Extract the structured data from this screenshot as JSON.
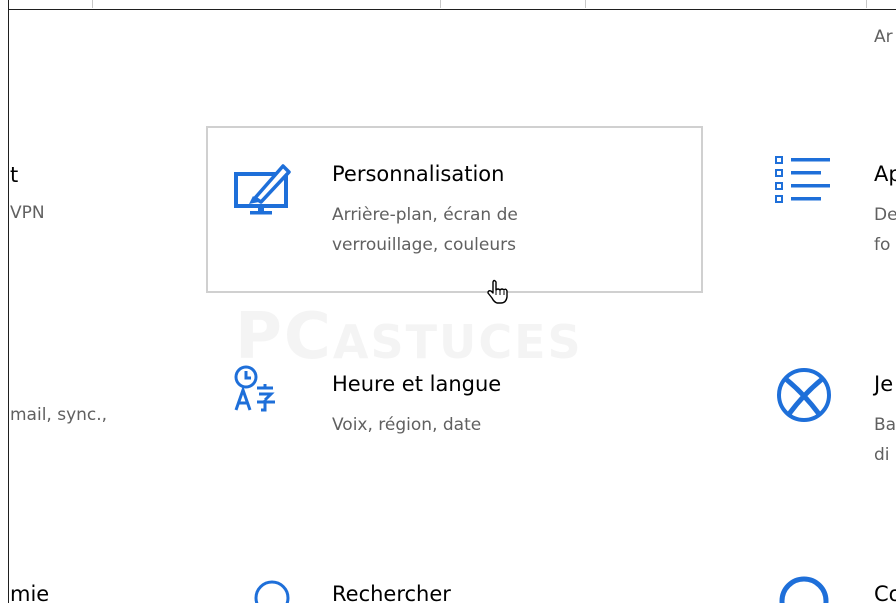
{
  "colors": {
    "accent": "#1e6fd9",
    "title": "#000000",
    "desc": "#606060",
    "hover_border": "#d0d0d0"
  },
  "top_right_partial": "Ar",
  "left_column": {
    "row1_title_fragment": "t",
    "row1_desc_fragment": "VPN",
    "row2_desc_fragment": "mail, sync.,",
    "row3_title_fragment": "mie"
  },
  "tiles": [
    {
      "id": "personnalisation",
      "title": "Personnalisation",
      "desc_line1": "Arrière-plan, écran de",
      "desc_line2": "verrouillage, couleurs",
      "icon": "personalization-icon"
    },
    {
      "id": "heure-langue",
      "title": "Heure et langue",
      "desc_line1": "Voix, région, date",
      "icon": "time-language-icon"
    },
    {
      "id": "rechercher",
      "title": "Rechercher",
      "icon": "search-icon"
    }
  ],
  "right_column": {
    "apps_title_fragment": "Ap",
    "apps_desc_line1_fragment": "De",
    "apps_desc_line2_fragment": "fo",
    "jeux_title_fragment": "Je",
    "jeux_desc_line1_fragment": "Ba",
    "jeux_desc_line2_fragment": "di",
    "bottom_title_fragment": "Co",
    "apps_icon": "apps-list-icon",
    "jeux_icon": "xbox-icon",
    "bottom_icon": "circle-icon"
  },
  "watermark": {
    "part1": "PC",
    "part2": "ASTUCES"
  }
}
